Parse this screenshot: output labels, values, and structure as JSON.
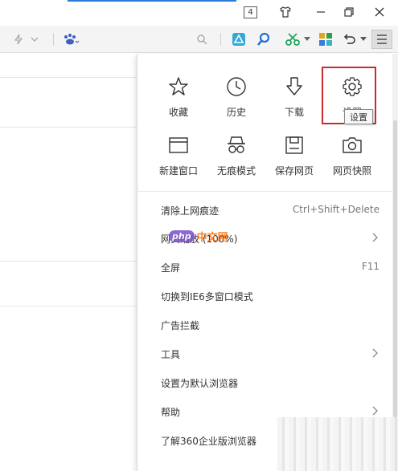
{
  "titlebar": {
    "tab_count": "4"
  },
  "toolbar": {
    "icons": [
      "lightning-icon",
      "baidu-paw-icon",
      "search-icon",
      "cloud-drive-icon",
      "magnifier-icon",
      "scissors-icon",
      "apps-grid-icon",
      "undo-icon",
      "menu-icon"
    ]
  },
  "menu": {
    "grid": [
      {
        "label": "收藏",
        "icon": "star-icon"
      },
      {
        "label": "历史",
        "icon": "clock-icon"
      },
      {
        "label": "下载",
        "icon": "download-icon"
      },
      {
        "label": "设置",
        "icon": "gear-icon"
      },
      {
        "label": "新建窗口",
        "icon": "new-window-icon"
      },
      {
        "label": "无痕模式",
        "icon": "incognito-icon"
      },
      {
        "label": "保存网页",
        "icon": "save-icon"
      },
      {
        "label": "网页快照",
        "icon": "camera-icon"
      }
    ],
    "tooltip": "设置",
    "items": [
      {
        "label": "清除上网痕迹",
        "shortcut": "Ctrl+Shift+Delete"
      },
      {
        "label": "网页缩放 (100%)",
        "shortcut": ""
      },
      {
        "label": "全屏",
        "shortcut": "F11"
      },
      {
        "label": "切换到IE6多窗口模式",
        "shortcut": ""
      },
      {
        "label": "广告拦截",
        "shortcut": ""
      },
      {
        "label": "工具",
        "shortcut": ""
      },
      {
        "label": "设置为默认浏览器",
        "shortcut": ""
      },
      {
        "label": "帮助",
        "shortcut": ""
      },
      {
        "label": "了解360企业版浏览器",
        "shortcut": ""
      }
    ]
  },
  "watermark": {
    "badge": "php",
    "text": "中文网"
  },
  "colors": {
    "highlight_border": "#c62d2d",
    "accent_blue": "#2a7bd6"
  }
}
